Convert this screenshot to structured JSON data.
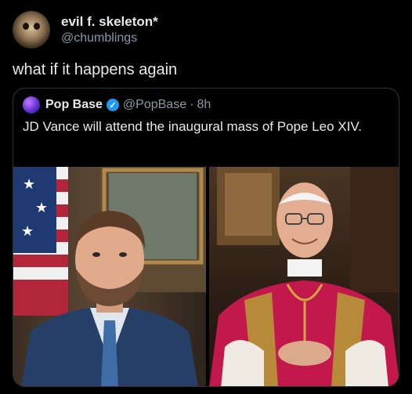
{
  "tweet": {
    "author": {
      "display_name": "evil f. skeleton*",
      "handle": "@chumblings",
      "avatar_icon": "skull-avatar-icon"
    },
    "text": "what if it happens again"
  },
  "quoted_tweet": {
    "author": {
      "display_name": "Pop Base",
      "verified": true,
      "handle": "@PopBase",
      "separator": "·",
      "time": "8h",
      "avatar_icon": "pop-base-avatar-icon"
    },
    "text": "JD Vance will attend the inaugural mass of Pope Leo XIV.",
    "images": [
      {
        "name": "jd-vance-portrait",
        "alt_description": ""
      },
      {
        "name": "pope-leo-portrait",
        "alt_description": ""
      }
    ]
  },
  "colors": {
    "background": "#000000",
    "text": "#e7e9ea",
    "secondary_text": "#8b98a5",
    "verified_badge": "#1d9bf0",
    "border": "#2f3336"
  }
}
